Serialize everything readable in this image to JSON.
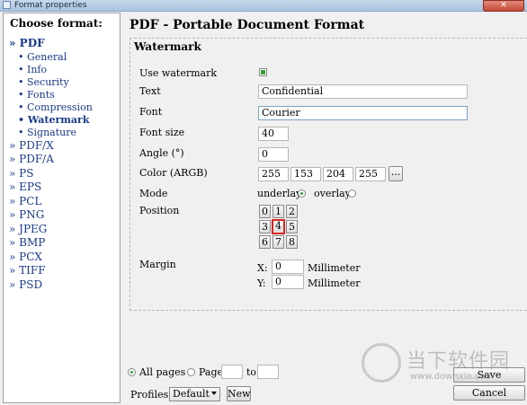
{
  "window": {
    "title": "Format properties",
    "close_glyph": "✕"
  },
  "sidebar": {
    "header": "Choose format:",
    "formats": [
      {
        "label": "» PDF",
        "active": true
      },
      {
        "label": "• General"
      },
      {
        "label": "• Info"
      },
      {
        "label": "• Security"
      },
      {
        "label": "• Fonts"
      },
      {
        "label": "• Compression"
      },
      {
        "label": "• Watermark",
        "active": true
      },
      {
        "label": "• Signature"
      },
      {
        "label": "» PDF/X"
      },
      {
        "label": "» PDF/A"
      },
      {
        "label": "» PS"
      },
      {
        "label": "» EPS"
      },
      {
        "label": "» PCL"
      },
      {
        "label": "» PNG"
      },
      {
        "label": "» JPEG"
      },
      {
        "label": "» BMP"
      },
      {
        "label": "» PCX"
      },
      {
        "label": "» TIFF"
      },
      {
        "label": "» PSD"
      }
    ]
  },
  "main": {
    "title": "PDF - Portable Document Format",
    "section_title": "Watermark",
    "use_watermark": {
      "label": "Use watermark",
      "checked": true
    },
    "text": {
      "label": "Text",
      "value": "Confidential"
    },
    "font": {
      "label": "Font",
      "value": "Courier"
    },
    "font_size": {
      "label": "Font size",
      "value": "40"
    },
    "angle": {
      "label": "Angle (°)",
      "value": "0"
    },
    "color": {
      "label": "Color (ARGB)",
      "a": "255",
      "r": "153",
      "g": "204",
      "b": "255",
      "button": "..."
    },
    "mode": {
      "label": "Mode",
      "option1": "underlay",
      "option2": "overlay",
      "selected": "underlay"
    },
    "position": {
      "label": "Position",
      "cells": [
        "0",
        "1",
        "2",
        "3",
        "4",
        "5",
        "6",
        "7",
        "8"
      ],
      "selected": "4"
    },
    "margin": {
      "label": "Margin",
      "x_label": "X:",
      "x_value": "0",
      "y_label": "Y:",
      "y_value": "0",
      "unit": "Millimeter"
    }
  },
  "footer": {
    "all_pages": "All pages",
    "page": "Page",
    "to": "to",
    "page_from": "",
    "page_to": "",
    "profiles_label": "Profiles:",
    "profile_value": "Default",
    "new_button": "New",
    "save_button": "Save",
    "cancel_button": "Cancel"
  },
  "overlay_watermark": {
    "text": "当下软件园",
    "url": "www.downxia.com"
  },
  "colors": {
    "accent_green": "#2fa22f",
    "link_blue": "#1a3a8a",
    "selected_red": "#dd2222"
  }
}
